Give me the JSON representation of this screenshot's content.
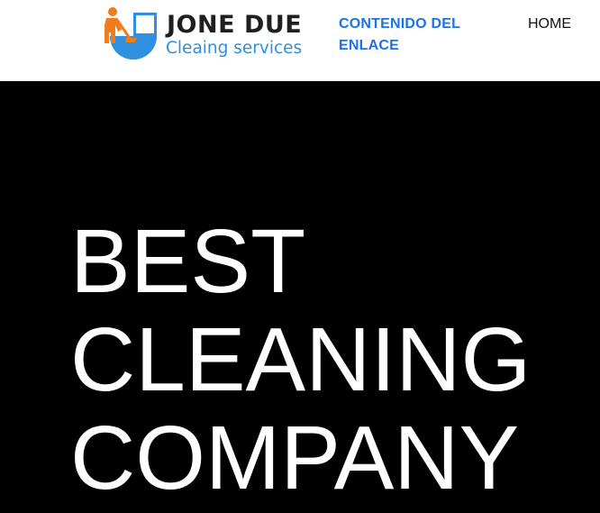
{
  "header": {
    "logo": {
      "title": "JONE DUE",
      "subtitle": "Cleaing services",
      "colors": {
        "figure": "#f07c1c",
        "circle": "#2f8fe0",
        "title": "#1f1f1f",
        "subtitle": "#2f8fe0"
      }
    },
    "nav": {
      "content_link": "CONTENIDO DEL ENLACE",
      "home_link": "HOME",
      "link_color": "#1a73e8"
    }
  },
  "hero": {
    "background": "#000000",
    "title_lines": [
      "BEST",
      "CLEANING",
      "COMPANY"
    ]
  }
}
